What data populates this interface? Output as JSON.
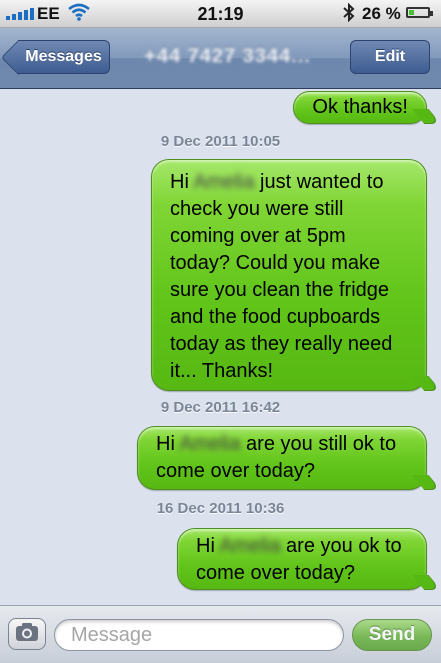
{
  "status_bar": {
    "carrier": "EE",
    "time": "21:19",
    "battery_percent": "26 %",
    "battery_level": 0.26,
    "icons": [
      "signal-icon",
      "wifi-icon",
      "bluetooth-icon",
      "battery-icon"
    ]
  },
  "nav": {
    "back_label": "Messages",
    "contact": "+44 7427 3344...",
    "edit_label": "Edit"
  },
  "messages": [
    {
      "type": "sent",
      "text": "Ok thanks!"
    },
    {
      "type": "timestamp",
      "text": "9 Dec 2011 10:05"
    },
    {
      "type": "sent",
      "prefix": "Hi",
      "name": "Amelia",
      "text": "just wanted to check you were still coming over at 5pm today? Could you make sure you clean the fridge and the food cupboards today as they really need it... Thanks!"
    },
    {
      "type": "timestamp",
      "text": "9 Dec 2011 16:42"
    },
    {
      "type": "sent",
      "prefix": "Hi",
      "name": "Amelia",
      "text": "are you still ok to come over today?"
    },
    {
      "type": "timestamp",
      "text": "16 Dec 2011 10:36"
    },
    {
      "type": "sent",
      "prefix": "Hi",
      "name": "Amelia",
      "text": "are you ok to come over today?"
    }
  ],
  "composer": {
    "placeholder": "Message",
    "send_label": "Send"
  },
  "colors": {
    "bubble_green": "#62c51a",
    "nav_blue": "#7f97b9",
    "background": "#dbe2ed"
  }
}
